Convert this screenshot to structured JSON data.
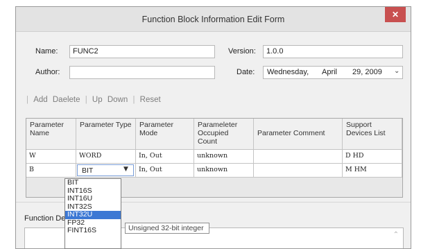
{
  "window": {
    "title": "Function Block Information Edit Form",
    "close_label": "✕"
  },
  "form": {
    "name_label": "Name:",
    "name_value": "FUNC2",
    "version_label": "Version:",
    "version_value": "1.0.0",
    "author_label": "Author:",
    "author_value": "",
    "date_label": "Date:",
    "date_weekday": "Wednesday,",
    "date_month": "April",
    "date_day_year": "29, 2009"
  },
  "toolbar": {
    "add": "Add",
    "delete": "Daelete",
    "up": "Up",
    "down": "Down",
    "reset": "Reset",
    "separator": "|"
  },
  "table": {
    "headers": [
      "Parameter Name",
      "Parameter Type",
      "Parameter Mode",
      "Parameleter Occupied Count",
      "Parameter Comment",
      "Support Devices List"
    ],
    "rows": [
      {
        "name": "W",
        "type": "WORD",
        "mode": "In, Out",
        "count": "unknown",
        "comment": "",
        "devices": "D HD"
      },
      {
        "name": "B",
        "type": "BIT",
        "mode": "In, Out",
        "count": "unknown",
        "comment": "",
        "devices": "M HM"
      }
    ]
  },
  "dropdown": {
    "options": [
      "BIT",
      "INT16S",
      "INT16U",
      "INT32S",
      "INT32U",
      "FP32",
      "FINT16S"
    ],
    "selected": "INT32U"
  },
  "tooltip": "Unsigned 32-bit integer",
  "description": {
    "label": "Function Desc"
  },
  "icons": {
    "dropdown_arrow": "chevron-down-icon",
    "scroll_up": "scroll-up-arrow-icon"
  }
}
